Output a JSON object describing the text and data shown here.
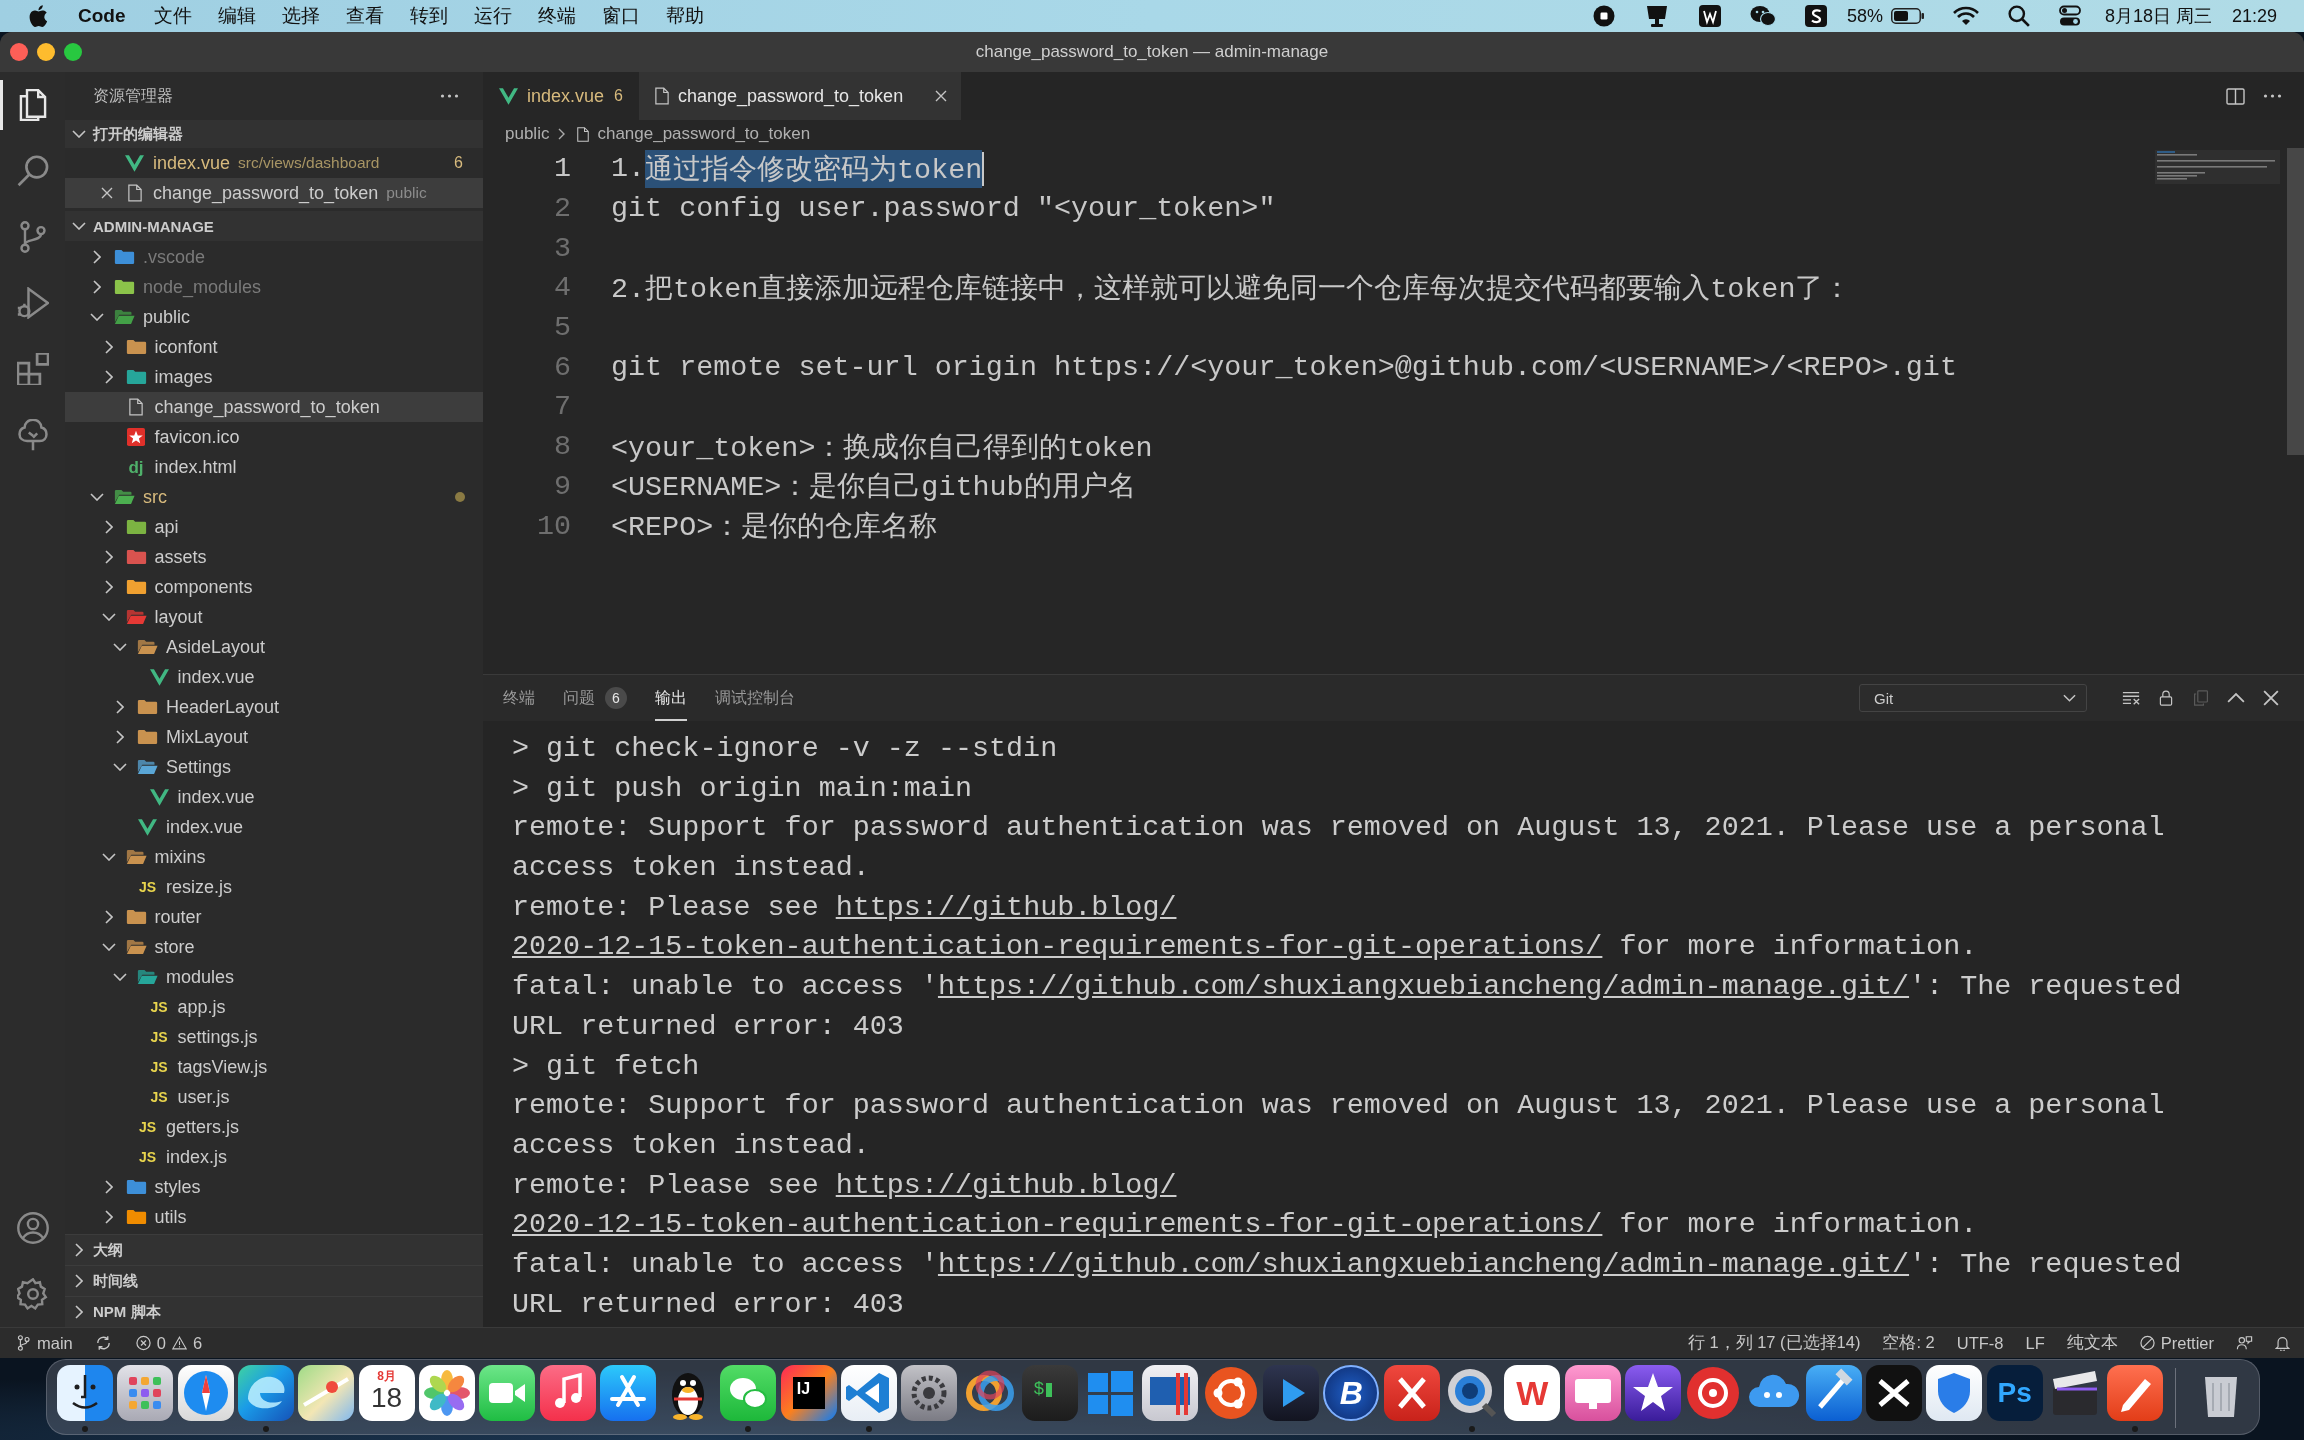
{
  "menu_bar": {
    "app": "Code",
    "menus": [
      "文件",
      "编辑",
      "选择",
      "查看",
      "转到",
      "运行",
      "终端",
      "窗口",
      "帮助"
    ],
    "battery": "58%",
    "date": "8月18日 周三",
    "time": "21:29"
  },
  "window": {
    "title": "change_password_to_token — admin-manage"
  },
  "activity_bar": {
    "top": [
      {
        "kind": "files",
        "selected": true
      },
      {
        "kind": "search",
        "selected": false
      },
      {
        "kind": "source-control",
        "selected": false
      },
      {
        "kind": "run-debug",
        "selected": false
      },
      {
        "kind": "extensions",
        "selected": false
      },
      {
        "kind": "tree",
        "selected": false
      }
    ],
    "bottom": [
      {
        "kind": "account"
      },
      {
        "kind": "settings"
      }
    ]
  },
  "sidebar": {
    "title": "资源管理器",
    "open_editors": {
      "title": "打开的编辑器",
      "expanded": true,
      "items": [
        {
          "name": "index.vue",
          "kind": "vue",
          "path": "src/views/dashboard",
          "count": "6",
          "warning": true,
          "close_visible": false,
          "selected": false
        },
        {
          "name": "change_password_to_token",
          "kind": "file",
          "path": "public",
          "warning": false,
          "close_visible": true,
          "selected": true
        }
      ]
    },
    "folder": {
      "title": "ADMIN-MANAGE",
      "expanded": true,
      "tree": [
        {
          "name": ".vscode",
          "kind": "folder",
          "color": "#3d8fd8",
          "expanded": false,
          "dimmed": true,
          "modified": false,
          "selected": false
        },
        {
          "name": "node_modules",
          "kind": "folder",
          "color": "#8bc34a",
          "expanded": false,
          "dimmed": true,
          "modified": false,
          "selected": false
        },
        {
          "name": "public",
          "kind": "folder",
          "color": "#43a047",
          "expanded": true,
          "dimmed": false,
          "modified": false,
          "selected": false,
          "children": [
            {
              "name": "iconfont",
              "kind": "folder",
              "color": "#c9924f",
              "expanded": false,
              "dimmed": false,
              "modified": false,
              "selected": false
            },
            {
              "name": "images",
              "kind": "folder",
              "color": "#26a69a",
              "expanded": false,
              "dimmed": false,
              "modified": false,
              "selected": false
            },
            {
              "name": "change_password_to_token",
              "kind": "file",
              "dimmed": false,
              "modified": false,
              "selected": true
            },
            {
              "name": "favicon.ico",
              "kind": "favicon",
              "dimmed": false,
              "modified": false,
              "selected": false
            },
            {
              "name": "index.html",
              "kind": "html",
              "icon_text": "dj",
              "dimmed": false,
              "modified": false,
              "selected": false
            }
          ]
        },
        {
          "name": "src",
          "kind": "folder",
          "color": "#4caf50",
          "expanded": true,
          "dimmed": false,
          "modified": true,
          "selected": false,
          "children": [
            {
              "name": "api",
              "kind": "folder",
              "color": "#7cb342",
              "expanded": false,
              "dimmed": false,
              "modified": false,
              "selected": false
            },
            {
              "name": "assets",
              "kind": "folder",
              "color": "#d9534f",
              "expanded": false,
              "dimmed": false,
              "modified": false,
              "selected": false
            },
            {
              "name": "components",
              "kind": "folder",
              "color": "#f0a030",
              "expanded": false,
              "dimmed": false,
              "modified": false,
              "selected": false
            },
            {
              "name": "layout",
              "kind": "folder",
              "color": "#e53935",
              "expanded": true,
              "dimmed": false,
              "modified": false,
              "selected": false,
              "children": [
                {
                  "name": "AsideLayout",
                  "kind": "folder",
                  "color": "#c9924f",
                  "expanded": true,
                  "dimmed": false,
                  "modified": false,
                  "selected": false,
                  "children": [
                    {
                      "name": "index.vue",
                      "kind": "vue",
                      "dimmed": false,
                      "modified": false,
                      "selected": false
                    }
                  ]
                },
                {
                  "name": "HeaderLayout",
                  "kind": "folder",
                  "color": "#c9924f",
                  "expanded": false,
                  "dimmed": false,
                  "modified": false,
                  "selected": false
                },
                {
                  "name": "MixLayout",
                  "kind": "folder",
                  "color": "#c9924f",
                  "expanded": false,
                  "dimmed": false,
                  "modified": false,
                  "selected": false
                },
                {
                  "name": "Settings",
                  "kind": "folder",
                  "color": "#5aa6d6",
                  "expanded": true,
                  "dimmed": false,
                  "modified": false,
                  "selected": false,
                  "children": [
                    {
                      "name": "index.vue",
                      "kind": "vue",
                      "dimmed": false,
                      "modified": false,
                      "selected": false
                    }
                  ]
                },
                {
                  "name": "index.vue",
                  "kind": "vue",
                  "dimmed": false,
                  "modified": false,
                  "selected": false
                }
              ]
            },
            {
              "name": "mixins",
              "kind": "folder",
              "color": "#c9924f",
              "expanded": true,
              "dimmed": false,
              "modified": false,
              "selected": false,
              "children": [
                {
                  "name": "resize.js",
                  "kind": "js",
                  "icon_text": "JS",
                  "dimmed": false,
                  "modified": false,
                  "selected": false
                }
              ]
            },
            {
              "name": "router",
              "kind": "folder",
              "color": "#c9924f",
              "expanded": false,
              "dimmed": false,
              "modified": false,
              "selected": false
            },
            {
              "name": "store",
              "kind": "folder",
              "color": "#c9924f",
              "expanded": true,
              "dimmed": false,
              "modified": false,
              "selected": false,
              "children": [
                {
                  "name": "modules",
                  "kind": "folder",
                  "color": "#26a69a",
                  "expanded": true,
                  "dimmed": false,
                  "modified": false,
                  "selected": false,
                  "children": [
                    {
                      "name": "app.js",
                      "kind": "js",
                      "icon_text": "JS",
                      "dimmed": false,
                      "modified": false,
                      "selected": false
                    },
                    {
                      "name": "settings.js",
                      "kind": "js",
                      "icon_text": "JS",
                      "dimmed": false,
                      "modified": false,
                      "selected": false
                    },
                    {
                      "name": "tagsView.js",
                      "kind": "js",
                      "icon_text": "JS",
                      "dimmed": false,
                      "modified": false,
                      "selected": false
                    },
                    {
                      "name": "user.js",
                      "kind": "js",
                      "icon_text": "JS",
                      "dimmed": false,
                      "modified": false,
                      "selected": false
                    }
                  ]
                },
                {
                  "name": "getters.js",
                  "kind": "js",
                  "icon_text": "JS",
                  "dimmed": false,
                  "modified": false,
                  "selected": false
                },
                {
                  "name": "index.js",
                  "kind": "js",
                  "icon_text": "JS",
                  "dimmed": false,
                  "modified": false,
                  "selected": false
                }
              ]
            },
            {
              "name": "styles",
              "kind": "folder",
              "color": "#3d8fd8",
              "expanded": false,
              "dimmed": false,
              "modified": false,
              "selected": false
            },
            {
              "name": "utils",
              "kind": "folder",
              "color": "#f08c00",
              "expanded": false,
              "dimmed": false,
              "modified": false,
              "selected": false
            }
          ]
        }
      ]
    },
    "sections": [
      {
        "title": "大纲",
        "expanded": false
      },
      {
        "title": "时间线",
        "expanded": false
      },
      {
        "title": "NPM 脚本",
        "expanded": false
      }
    ]
  },
  "editor": {
    "tabs": [
      {
        "label": "index.vue",
        "kind": "vue",
        "badge": "6",
        "warning": true,
        "selected": false,
        "close_visible": false
      },
      {
        "label": "change_password_to_token",
        "kind": "file",
        "warning": false,
        "selected": true,
        "close_visible": true
      }
    ],
    "breadcrumb": [
      {
        "label": "public",
        "kind": "folder"
      },
      {
        "label": "change_password_to_token",
        "kind": "file"
      }
    ],
    "lines": [
      {
        "number": "1",
        "active": true,
        "segments": [
          {
            "text": "1.",
            "selected": false
          },
          {
            "text": "通过指令修改密码为token",
            "selected": true
          }
        ]
      },
      {
        "number": "2",
        "active": false,
        "segments": [
          {
            "text": "git config user.password \"<your_token>\"",
            "selected": false
          }
        ]
      },
      {
        "number": "3",
        "active": false
      },
      {
        "number": "4",
        "active": false,
        "segments": [
          {
            "text": "2.把token直接添加远程仓库链接中，这样就可以避免同一个仓库每次提交代码都要输入token了：",
            "selected": false
          }
        ]
      },
      {
        "number": "5",
        "active": false
      },
      {
        "number": "6",
        "active": false,
        "segments": [
          {
            "text": "git remote set-url origin https://<your_token>@github.com/<USERNAME>/<REPO>.git",
            "selected": false
          }
        ]
      },
      {
        "number": "7",
        "active": false
      },
      {
        "number": "8",
        "active": false,
        "segments": [
          {
            "text": "<your_token>：换成你自己得到的token",
            "selected": false
          }
        ]
      },
      {
        "number": "9",
        "active": false,
        "segments": [
          {
            "text": "<USERNAME>：是你自己github的用户名",
            "selected": false
          }
        ]
      },
      {
        "number": "10",
        "active": false,
        "segments": [
          {
            "text": "<REPO>：是你的仓库名称",
            "selected": false
          }
        ]
      }
    ]
  },
  "panel": {
    "tabs": [
      {
        "label": "终端",
        "selected": false
      },
      {
        "label": "问题",
        "badge": "6",
        "selected": false
      },
      {
        "label": "输出",
        "selected": true
      },
      {
        "label": "调试控制台",
        "selected": false
      }
    ],
    "channel": "Git",
    "output": [
      [
        {
          "kind": "text",
          "text": "> git check-ignore -v -z --stdin"
        }
      ],
      [
        {
          "kind": "text",
          "text": "> git push origin main:main"
        }
      ],
      [
        {
          "kind": "text",
          "text": "remote: Support for password authentication was removed on August 13, 2021. Please use a personal"
        }
      ],
      [
        {
          "kind": "text",
          "text": "access token instead."
        }
      ],
      [
        {
          "kind": "text",
          "text": "remote: Please see "
        },
        {
          "kind": "link",
          "text": "https://github.blog/"
        }
      ],
      [
        {
          "kind": "link",
          "text": "2020-12-15-token-authentication-requirements-for-git-operations/"
        },
        {
          "kind": "text",
          "text": " for more information."
        }
      ],
      [
        {
          "kind": "text",
          "text": "fatal: unable to access '"
        },
        {
          "kind": "link",
          "text": "https://github.com/shuxiangxuebiancheng/admin-manage.git/"
        },
        {
          "kind": "text",
          "text": "': The requested"
        }
      ],
      [
        {
          "kind": "text",
          "text": "URL returned error: 403"
        }
      ],
      [
        {
          "kind": "text",
          "text": "> git fetch"
        }
      ],
      [
        {
          "kind": "text",
          "text": "remote: Support for password authentication was removed on August 13, 2021. Please use a personal"
        }
      ],
      [
        {
          "kind": "text",
          "text": "access token instead."
        }
      ],
      [
        {
          "kind": "text",
          "text": "remote: Please see "
        },
        {
          "kind": "link",
          "text": "https://github.blog/"
        }
      ],
      [
        {
          "kind": "link",
          "text": "2020-12-15-token-authentication-requirements-for-git-operations/"
        },
        {
          "kind": "text",
          "text": " for more information."
        }
      ],
      [
        {
          "kind": "text",
          "text": "fatal: unable to access '"
        },
        {
          "kind": "link",
          "text": "https://github.com/shuxiangxuebiancheng/admin-manage.git/"
        },
        {
          "kind": "text",
          "text": "': The requested"
        }
      ],
      [
        {
          "kind": "text",
          "text": "URL returned error: 403"
        }
      ]
    ]
  },
  "status_bar": {
    "branch": "main",
    "errors": "0",
    "warnings": "6",
    "position": "行 1，列 17 (已选择14)",
    "indent": "空格: 2",
    "encoding": "UTF-8",
    "eol": "LF",
    "language": "纯文本",
    "formatter": "Prettier"
  },
  "dock": [
    {
      "kind": "face",
      "running": true
    },
    {
      "kind": "grid",
      "running": false
    },
    {
      "kind": "compass",
      "running": false
    },
    {
      "kind": "swirl",
      "running": true
    },
    {
      "kind": "map",
      "running": false
    },
    {
      "kind": "calendar",
      "month": "8月",
      "day": "18",
      "running": false
    },
    {
      "kind": "flower",
      "running": false
    },
    {
      "kind": "camera",
      "running": false
    },
    {
      "kind": "note",
      "running": false
    },
    {
      "kind": "store",
      "running": false
    },
    {
      "kind": "penguin",
      "running": false
    },
    {
      "kind": "bubbles",
      "running": true
    },
    {
      "kind": "letters",
      "label": "IJ",
      "running": false
    },
    {
      "kind": "ribbon",
      "running": true
    },
    {
      "kind": "gear",
      "running": false
    },
    {
      "kind": "ring",
      "running": false
    },
    {
      "kind": "terminal",
      "label": "$",
      "running": false
    },
    {
      "kind": "windows",
      "running": false
    },
    {
      "kind": "bars",
      "running": false
    },
    {
      "kind": "nodes",
      "running": false
    },
    {
      "kind": "play",
      "running": false
    },
    {
      "kind": "bcircle",
      "label": "B",
      "running": false
    },
    {
      "kind": "cross",
      "running": false
    },
    {
      "kind": "magnifier",
      "running": true
    },
    {
      "kind": "wtile",
      "label": "W",
      "running": false
    },
    {
      "kind": "screen",
      "running": false
    },
    {
      "kind": "star",
      "running": false
    },
    {
      "kind": "disc",
      "running": false
    },
    {
      "kind": "cloud",
      "running": false
    },
    {
      "kind": "hammer",
      "running": false
    },
    {
      "kind": "scissors",
      "running": false
    },
    {
      "kind": "shield",
      "running": false
    },
    {
      "kind": "pstile",
      "label": "Ps",
      "running": false
    },
    {
      "kind": "clapper",
      "running": false
    },
    {
      "kind": "pen",
      "running": true
    },
    {
      "kind": "trash",
      "running": false
    }
  ]
}
